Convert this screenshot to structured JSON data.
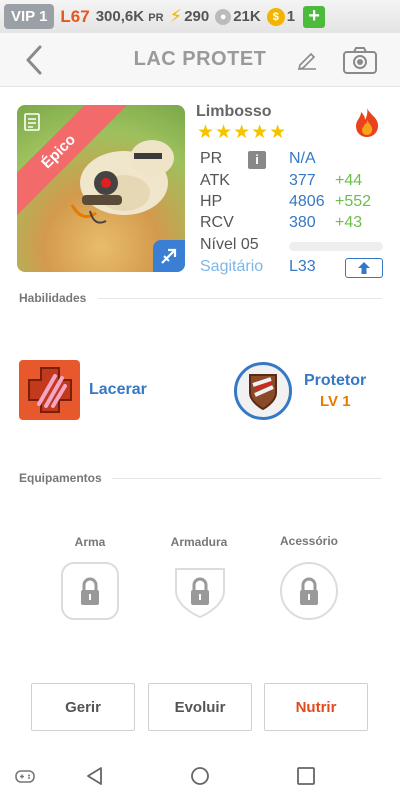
{
  "status_bar": {
    "vip": "VIP 1",
    "level": "L67",
    "power": "300,6K",
    "power_unit": "PR",
    "energy": "290",
    "food": "21K",
    "coins": "1",
    "plus": "+"
  },
  "header": {
    "title": "LAC PROTET"
  },
  "monster": {
    "rarity": "Épico",
    "name": "Limbosso",
    "stars": "★★★★★",
    "star_count": 5,
    "element": "fire",
    "stats": {
      "pr_label": "PR",
      "pr_info": "i",
      "pr_value": "N/A",
      "atk_label": "ATK",
      "atk_value": "377",
      "atk_bonus": "+44",
      "hp_label": "HP",
      "hp_value": "4806",
      "hp_bonus": "+552",
      "rcv_label": "RCV",
      "rcv_value": "380",
      "rcv_bonus": "+43",
      "level_label": "Nível 05",
      "level_progress": 0.0,
      "sign_label": "Sagitário",
      "sign_level": "L33"
    }
  },
  "skills_section": {
    "title": "Habilidades",
    "skill1_name": "Lacerar",
    "skill2_name": "Protetor",
    "skill2_level": "LV 1"
  },
  "equipment_section": {
    "title": "Equipamentos",
    "slot1": "Arma",
    "slot2": "Armadura",
    "slot3": "Acessório"
  },
  "actions": {
    "manage": "Gerir",
    "evolve": "Evoluir",
    "feed": "Nutrir"
  },
  "colors": {
    "accent_blue": "#3579c4",
    "bonus_green": "#6cbf4a",
    "level_orange": "#e87a00",
    "feed_red": "#e04a1c",
    "rarity_ribbon": "#f36a6a"
  }
}
